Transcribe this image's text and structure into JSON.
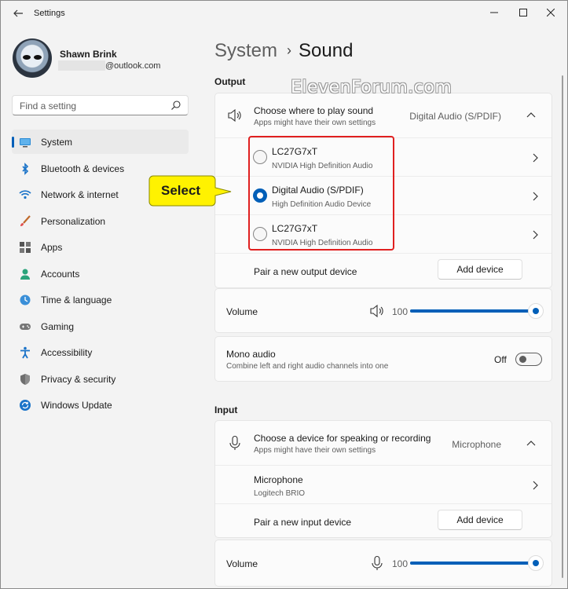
{
  "window": {
    "title": "Settings",
    "back": "←",
    "minimize": "—",
    "maximize": "☐",
    "close": "✕"
  },
  "profile": {
    "name": "Shawn Brink",
    "email_visible": "@outlook.com"
  },
  "search": {
    "placeholder": "Find a setting"
  },
  "nav": [
    {
      "label": "System",
      "icon": "system-icon",
      "active": true
    },
    {
      "label": "Bluetooth & devices",
      "icon": "bluetooth-icon"
    },
    {
      "label": "Network & internet",
      "icon": "wifi-icon"
    },
    {
      "label": "Personalization",
      "icon": "brush-icon"
    },
    {
      "label": "Apps",
      "icon": "apps-icon"
    },
    {
      "label": "Accounts",
      "icon": "person-icon"
    },
    {
      "label": "Time & language",
      "icon": "globe-clock-icon"
    },
    {
      "label": "Gaming",
      "icon": "gamepad-icon"
    },
    {
      "label": "Accessibility",
      "icon": "accessibility-icon"
    },
    {
      "label": "Privacy & security",
      "icon": "shield-icon"
    },
    {
      "label": "Windows Update",
      "icon": "update-icon"
    }
  ],
  "breadcrumb": {
    "parent": "System",
    "separator": "›",
    "current": "Sound"
  },
  "output": {
    "section_label": "Output",
    "choose": {
      "title": "Choose where to play sound",
      "subtitle": "Apps might have their own settings",
      "value": "Digital Audio (S/PDIF)"
    },
    "devices": [
      {
        "name": "LC27G7xT",
        "driver": "NVIDIA High Definition Audio",
        "selected": false
      },
      {
        "name": "Digital Audio (S/PDIF)",
        "driver": "High Definition Audio Device",
        "selected": true
      },
      {
        "name": "LC27G7xT",
        "driver": "NVIDIA High Definition Audio",
        "selected": false
      }
    ],
    "pair": {
      "label": "Pair a new output device",
      "button": "Add device"
    },
    "volume": {
      "label": "Volume",
      "value": "100",
      "level": 1.0
    },
    "mono": {
      "title": "Mono audio",
      "subtitle": "Combine left and right audio channels into one",
      "state": "Off"
    }
  },
  "input": {
    "section_label": "Input",
    "choose": {
      "title": "Choose a device for speaking or recording",
      "subtitle": "Apps might have their own settings",
      "value": "Microphone"
    },
    "device": {
      "name": "Microphone",
      "driver": "Logitech BRIO"
    },
    "pair": {
      "label": "Pair a new input device",
      "button": "Add device"
    },
    "volume": {
      "label": "Volume",
      "value": "100",
      "level": 1.0
    }
  },
  "annotation": {
    "callout": "Select",
    "watermark": "ElevenForum.com"
  },
  "colors": {
    "accent": "#005fb8",
    "highlight": "#e02020",
    "callout_fill": "#fff200"
  }
}
